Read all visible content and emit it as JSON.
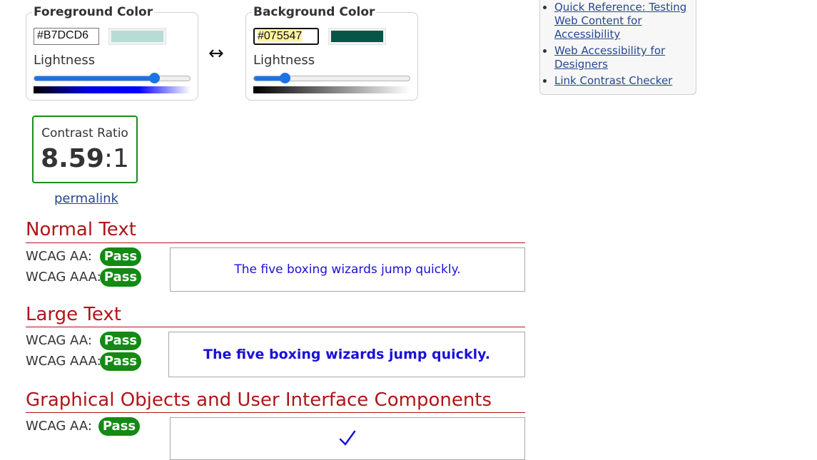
{
  "foreground": {
    "legend": "Foreground Color",
    "hex": "#B7DCD6",
    "swatch_color": "#B7DCD6",
    "lightness_label": "Lightness",
    "lightness_value": 0.77,
    "gradient": [
      "#000000",
      "#0000e0",
      "#0000ff",
      "#ffffff"
    ]
  },
  "swap": {
    "symbol": "↔"
  },
  "background": {
    "legend": "Background Color",
    "hex": "#075547",
    "swatch_color": "#075547",
    "lightness_label": "Lightness",
    "lightness_value": 0.2,
    "gradient": [
      "#000000",
      "#ffffff"
    ]
  },
  "contrast": {
    "label": "Contrast Ratio",
    "value": "8.59",
    "suffix": ":1",
    "border_color": "#1e8a1e",
    "permalink": "permalink"
  },
  "sections": {
    "normal": {
      "title": "Normal Text",
      "aa_label": "WCAG AA:",
      "aa_result": "Pass",
      "aaa_label": "WCAG AAA:",
      "aaa_result": "Pass",
      "sample": "The five boxing wizards jump quickly."
    },
    "large": {
      "title": "Large Text",
      "aa_label": "WCAG AA:",
      "aa_result": "Pass",
      "aaa_label": "WCAG AAA:",
      "aaa_result": "Pass",
      "sample": "The five boxing wizards jump quickly."
    },
    "graphical": {
      "title": "Graphical Objects and User Interface Components",
      "aa_label": "WCAG AA:",
      "aa_result": "Pass",
      "sample_icon": "check-icon"
    }
  },
  "sidebar": {
    "links": [
      "Quick Reference: Testing Web Content for Accessibility",
      "Web Accessibility for Designers",
      "Link Contrast Checker"
    ]
  },
  "colors": {
    "pass": "#138a13",
    "section_title": "#b0151a",
    "sample_text": "#1b10d6",
    "slider": "#1a73e8",
    "link": "#26488d"
  }
}
